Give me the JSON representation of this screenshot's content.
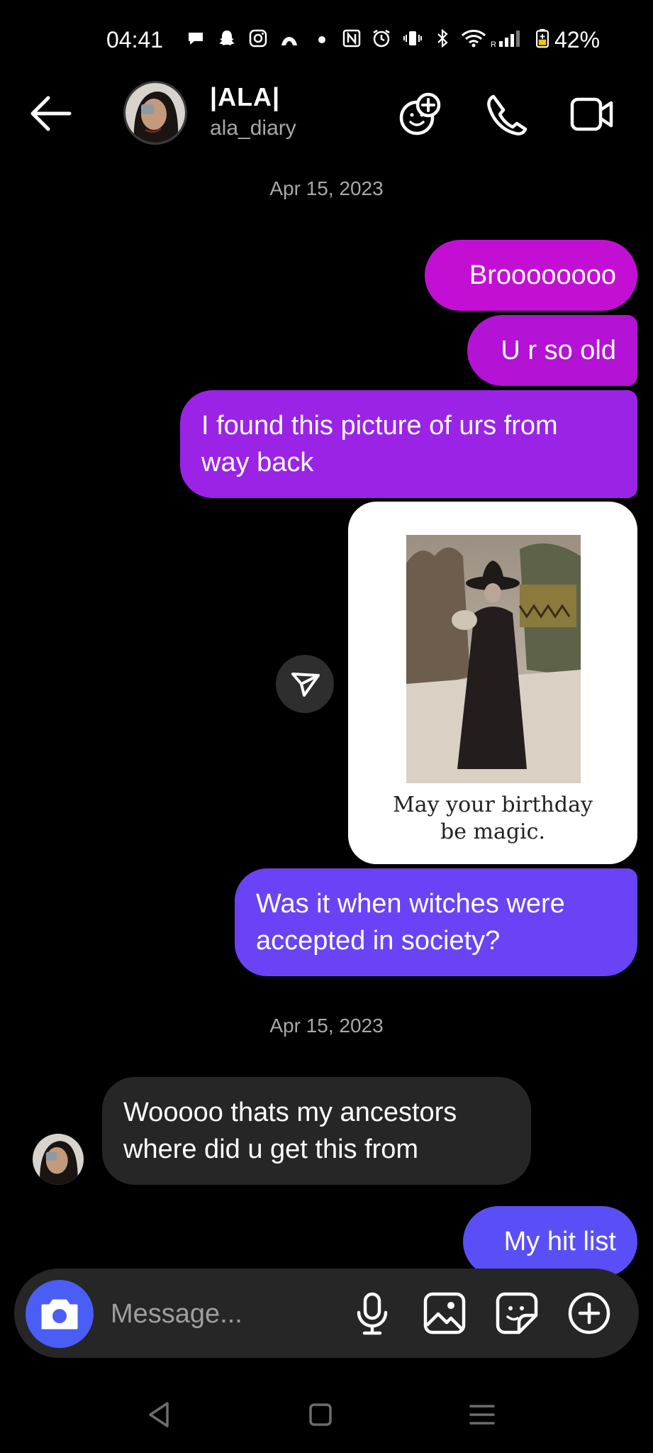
{
  "status_bar": {
    "time": "04:41",
    "battery": "42%",
    "icons": [
      "chat-bubble-icon",
      "snapchat-icon",
      "instagram-icon",
      "arc-icon",
      "dot-icon",
      "nfc-icon",
      "alarm-icon",
      "vibrate-icon",
      "bluetooth-icon",
      "wifi-icon",
      "signal-icon",
      "battery-icon"
    ]
  },
  "header": {
    "name": "|ALA|",
    "handle": "ala_diary",
    "actions": [
      "add-people-icon",
      "phone-icon",
      "video-icon"
    ]
  },
  "messages": {
    "date1": "Apr 15, 2023",
    "m1": "Broooooooo",
    "m2": "U r so old",
    "m3_l1": "I found this picture of urs from",
    "m3_l2": "way back",
    "card_caption_l1": "May your birthday",
    "card_caption_l2": "be magic.",
    "m4_l1": "Was it when witches were",
    "m4_l2": "accepted in society?",
    "date2": "Apr 15, 2023",
    "m5_l1": "Wooooo thats my ancestors",
    "m5_l2": "where did u get this from",
    "m6": "My hit list"
  },
  "composer": {
    "placeholder": "Message..."
  },
  "colors": {
    "accent": "#4a5df5",
    "bubble_magenta": "#c30fd4",
    "bubble_purple": "#9a23e6",
    "bubble_violet": "#6943f5",
    "bubble_incoming": "#262626"
  }
}
